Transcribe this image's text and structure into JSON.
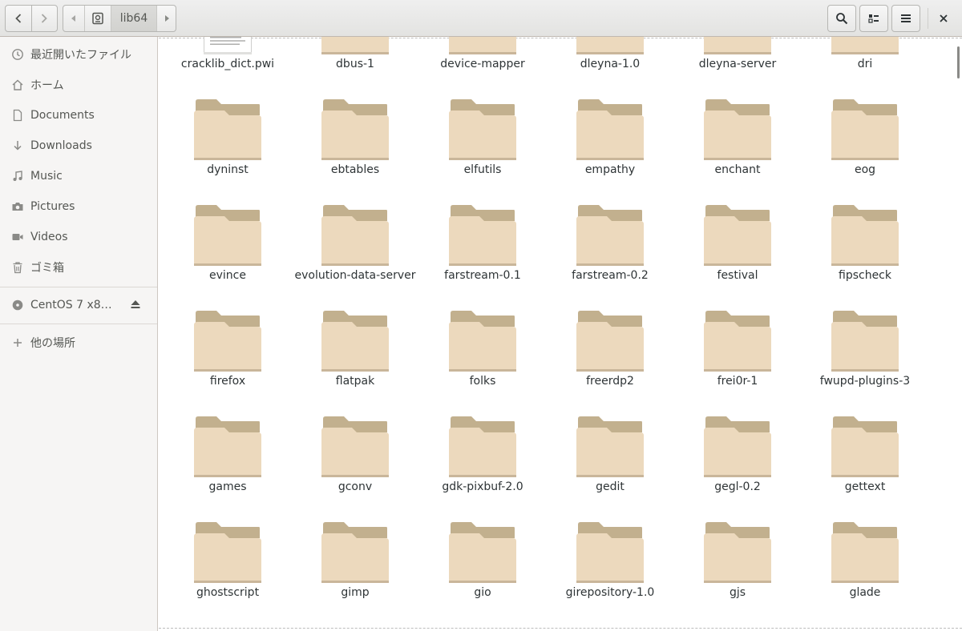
{
  "header": {
    "path_label": "lib64"
  },
  "sidebar": {
    "items": [
      {
        "label": "最近開いたファイル",
        "icon": "recent-icon"
      },
      {
        "label": "ホーム",
        "icon": "home-icon"
      },
      {
        "label": "Documents",
        "icon": "document-icon"
      },
      {
        "label": "Downloads",
        "icon": "download-icon"
      },
      {
        "label": "Music",
        "icon": "music-icon"
      },
      {
        "label": "Pictures",
        "icon": "camera-icon"
      },
      {
        "label": "Videos",
        "icon": "video-icon"
      },
      {
        "label": "ゴミ箱",
        "icon": "trash-icon"
      }
    ],
    "drive": {
      "label": "CentOS 7 x8…",
      "icon": "disc-icon"
    },
    "other": {
      "label": "他の場所",
      "icon": "plus-icon"
    }
  },
  "files": {
    "rows": [
      [
        {
          "name": "cracklib_dict.pwi",
          "type": "document"
        },
        {
          "name": "dbus-1",
          "type": "folder"
        },
        {
          "name": "device-mapper",
          "type": "folder"
        },
        {
          "name": "dleyna-1.0",
          "type": "folder"
        },
        {
          "name": "dleyna-server",
          "type": "folder"
        },
        {
          "name": "dri",
          "type": "folder"
        }
      ],
      [
        {
          "name": "dyninst",
          "type": "folder"
        },
        {
          "name": "ebtables",
          "type": "folder"
        },
        {
          "name": "elfutils",
          "type": "folder"
        },
        {
          "name": "empathy",
          "type": "folder"
        },
        {
          "name": "enchant",
          "type": "folder"
        },
        {
          "name": "eog",
          "type": "folder"
        }
      ],
      [
        {
          "name": "evince",
          "type": "folder"
        },
        {
          "name": "evolution-data-server",
          "type": "folder"
        },
        {
          "name": "farstream-0.1",
          "type": "folder"
        },
        {
          "name": "farstream-0.2",
          "type": "folder"
        },
        {
          "name": "festival",
          "type": "folder"
        },
        {
          "name": "fipscheck",
          "type": "folder"
        }
      ],
      [
        {
          "name": "firefox",
          "type": "folder"
        },
        {
          "name": "flatpak",
          "type": "folder"
        },
        {
          "name": "folks",
          "type": "folder"
        },
        {
          "name": "freerdp2",
          "type": "folder"
        },
        {
          "name": "frei0r-1",
          "type": "folder"
        },
        {
          "name": "fwupd-plugins-3",
          "type": "folder"
        }
      ],
      [
        {
          "name": "games",
          "type": "folder"
        },
        {
          "name": "gconv",
          "type": "folder"
        },
        {
          "name": "gdk-pixbuf-2.0",
          "type": "folder"
        },
        {
          "name": "gedit",
          "type": "folder"
        },
        {
          "name": "gegl-0.2",
          "type": "folder"
        },
        {
          "name": "gettext",
          "type": "folder"
        }
      ],
      [
        {
          "name": "ghostscript",
          "type": "folder"
        },
        {
          "name": "gimp",
          "type": "folder"
        },
        {
          "name": "gio",
          "type": "folder"
        },
        {
          "name": "girepository-1.0",
          "type": "folder"
        },
        {
          "name": "gjs",
          "type": "folder"
        },
        {
          "name": "glade",
          "type": "folder"
        }
      ]
    ]
  },
  "colors": {
    "folder_back": "#c2b08e",
    "folder_front": "#ecd9bd",
    "sidebar_bg": "#f6f5f4",
    "header_bg": "#e8e8e7"
  }
}
